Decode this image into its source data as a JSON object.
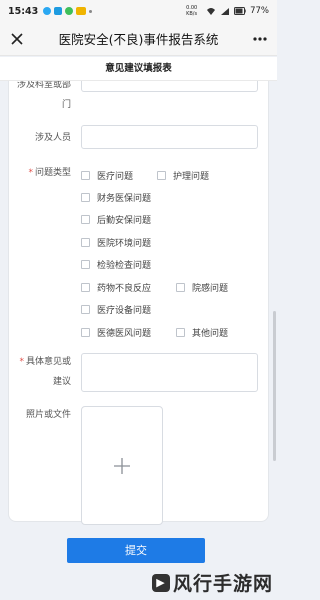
{
  "status_bar": {
    "time": "15:43",
    "network": "0.00 KB/s",
    "battery": "77%"
  },
  "header": {
    "title": "医院安全(不良)事件报告系统",
    "subtitle": "意见建议填报表"
  },
  "form": {
    "dept_label_line1": "涉及科室或部",
    "dept_label_line2": "门",
    "person_label": "涉及人员",
    "type_label": "问题类型",
    "type_options": [
      "医疗问题",
      "护理问题",
      "财务医保问题",
      "后勤安保问题",
      "医院环境问题",
      "检验检查问题",
      "药物不良反应",
      "院感问题",
      "医疗设备问题",
      "医德医风问题",
      "其他问题"
    ],
    "suggestion_label_line1": "具体意见或",
    "suggestion_label_line2": "建议",
    "attachment_label": "照片或文件",
    "required_mark": "*",
    "submit_label": "提交"
  },
  "icons": {
    "close": "close-icon",
    "menu": "more-icon",
    "upload": "plus-icon"
  },
  "colors": {
    "accent": "#1e7be6",
    "required": "#e0504a"
  },
  "watermark": "风行手游网"
}
